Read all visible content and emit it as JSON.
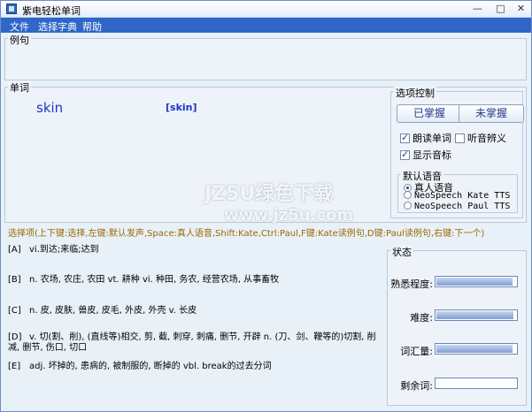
{
  "window": {
    "title": "紫电轻松单词"
  },
  "menu": {
    "file": "文件",
    "dict": "选择字典",
    "help": "帮助"
  },
  "sections": {
    "example": "例句",
    "word": "单词",
    "options": "选项控制",
    "status": "状态"
  },
  "word": {
    "text": "skin",
    "phonetic": "[skin]"
  },
  "controls": {
    "mastered": "已掌握",
    "not_mastered": "未掌握",
    "read_word": "朗读单词",
    "listen_meaning": "听音辨义",
    "show_phonetic": "显示音标",
    "read_word_checked": true,
    "listen_meaning_checked": false,
    "show_phonetic_checked": true,
    "voice_group": "默认语音",
    "voices": [
      "真人语音",
      "NeoSpeech Kate TTS",
      "NeoSpeech Paul TTS"
    ],
    "voice_selected": 0
  },
  "hint": "选择项(上下键:选择,左键:默认发声,Space:真人语音,Shift:Kate,Ctrl:Paul,F键:Kate读例句,D键:Paul读例句,右键:下一个)",
  "options": [
    {
      "key": "[A]",
      "text": "vi.到达;来临;达到"
    },
    {
      "key": "[B]",
      "text": "n. 农场, 农庄, 农田 vt. 耕种 vi. 种田, 务农, 经营农场, 从事畜牧"
    },
    {
      "key": "[C]",
      "text": "n. 皮, 皮肤, 兽皮, 皮毛, 外皮, 外壳 v. 长皮"
    },
    {
      "key": "[D]",
      "text": "v. 切(割、削), (直线等)相交, 剪, 截, 刺穿, 刺痛, 删节, 开辟 n. (刀、剑、鞭等的)切割, 削减, 删节, 伤口, 切口"
    },
    {
      "key": "[E]",
      "text": "adj. 坏掉的, 患病的, 被制服的, 断掉的 vbl. break的过去分词"
    }
  ],
  "status": {
    "familiarity": {
      "label": "熟悉程度:",
      "level": 0.95
    },
    "difficulty": {
      "label": "难度:",
      "level": 0.97
    },
    "vocabulary": {
      "label": "词汇量:",
      "level": 0.95
    },
    "remaining": {
      "label": "剩余词:",
      "level": 0.0
    }
  },
  "watermark": {
    "line1": "JZ5U绿色下载",
    "line2": "www.jz5u.com"
  }
}
